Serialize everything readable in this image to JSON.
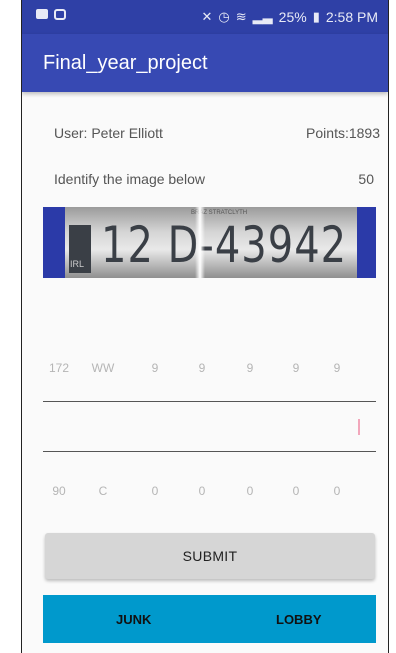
{
  "status_bar": {
    "time": "2:58 PM",
    "battery": "25%",
    "icons": [
      "image-icon",
      "download-icon",
      "vibrate-icon",
      "alarm-icon",
      "wifi-icon",
      "signal-icon",
      "battery-icon"
    ]
  },
  "app": {
    "title": "Final_year_project"
  },
  "user": {
    "label": "User: Peter Elliott",
    "points": "Points:1893"
  },
  "task": {
    "prompt": "Identify the image below",
    "value": "50"
  },
  "plate": {
    "main_text": "12 D-43942",
    "top_text": "BRAZ STRATCLYTH",
    "country": "IRL"
  },
  "values_top": [
    "172",
    "WW",
    "9",
    "9",
    "9",
    "9",
    "9"
  ],
  "values_bottom": [
    "90",
    "C",
    "0",
    "0",
    "0",
    "0",
    "0"
  ],
  "input": {
    "value": ""
  },
  "buttons": {
    "submit": "SUBMIT",
    "junk": "JUNK",
    "lobby": "LOBBY"
  },
  "colors": {
    "status_bar": "#2f40a6",
    "app_bar": "#3749b3",
    "bottom_bar": "#0099cc",
    "submit_bg": "#d6d6d6",
    "caret": "#f2a7bb"
  }
}
